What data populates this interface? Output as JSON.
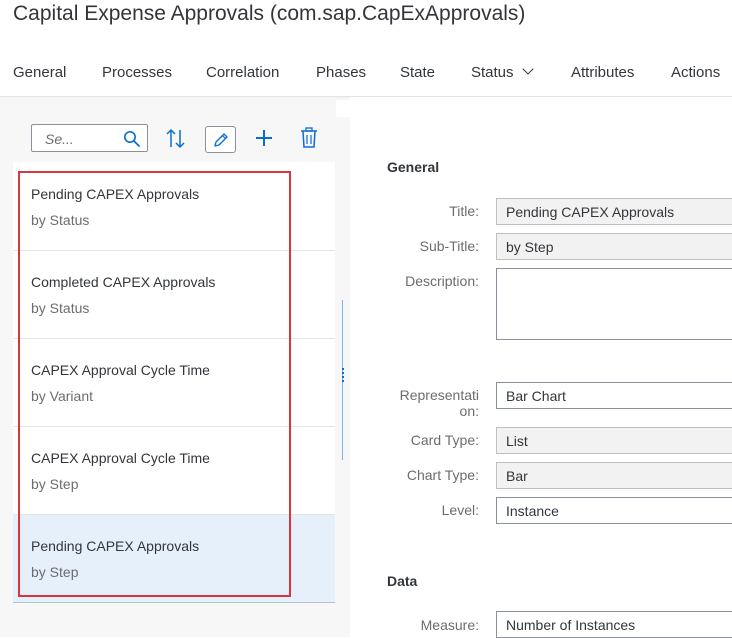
{
  "app": {
    "title": "Capital Expense Approvals (com.sap.CapExApprovals)"
  },
  "tabs": [
    {
      "label": "General"
    },
    {
      "label": "Processes"
    },
    {
      "label": "Correlation"
    },
    {
      "label": "Phases"
    },
    {
      "label": "State"
    },
    {
      "label": "Status"
    },
    {
      "label": "Attributes"
    },
    {
      "label": "Actions"
    }
  ],
  "toolbar": {
    "search_placeholder": "Se...",
    "icons": [
      "search-icon",
      "sort-icon",
      "edit-icon",
      "add-icon",
      "delete-icon"
    ]
  },
  "list": [
    {
      "title": "Pending CAPEX Approvals",
      "subtitle": "by Status"
    },
    {
      "title": "Completed CAPEX Approvals",
      "subtitle": "by Status"
    },
    {
      "title": "CAPEX Approval Cycle Time",
      "subtitle": "by Variant"
    },
    {
      "title": "CAPEX Approval Cycle Time",
      "subtitle": "by Step"
    },
    {
      "title": "Pending CAPEX Approvals",
      "subtitle": "by Step"
    }
  ],
  "detail": {
    "general_title": "General",
    "title_label": "Title:",
    "title_value": "Pending CAPEX Approvals",
    "subtitle_label": "Sub-Title:",
    "subtitle_value": "by Step",
    "description_label": "Description:",
    "description_value": "",
    "representation_label_1": "Representati",
    "representation_label_2": "on:",
    "representation_value": "Bar Chart",
    "cardtype_label": "Card Type:",
    "cardtype_value": "List",
    "charttype_label": "Chart Type:",
    "charttype_value": "Bar",
    "level_label": "Level:",
    "level_value": "Instance",
    "data_title": "Data",
    "measure_label": "Measure:",
    "measure_value": "Number of Instances"
  },
  "colors": {
    "accent": "#0a6ed1",
    "highlight": "#d9353f",
    "selected_bg": "#e5f0fa"
  }
}
